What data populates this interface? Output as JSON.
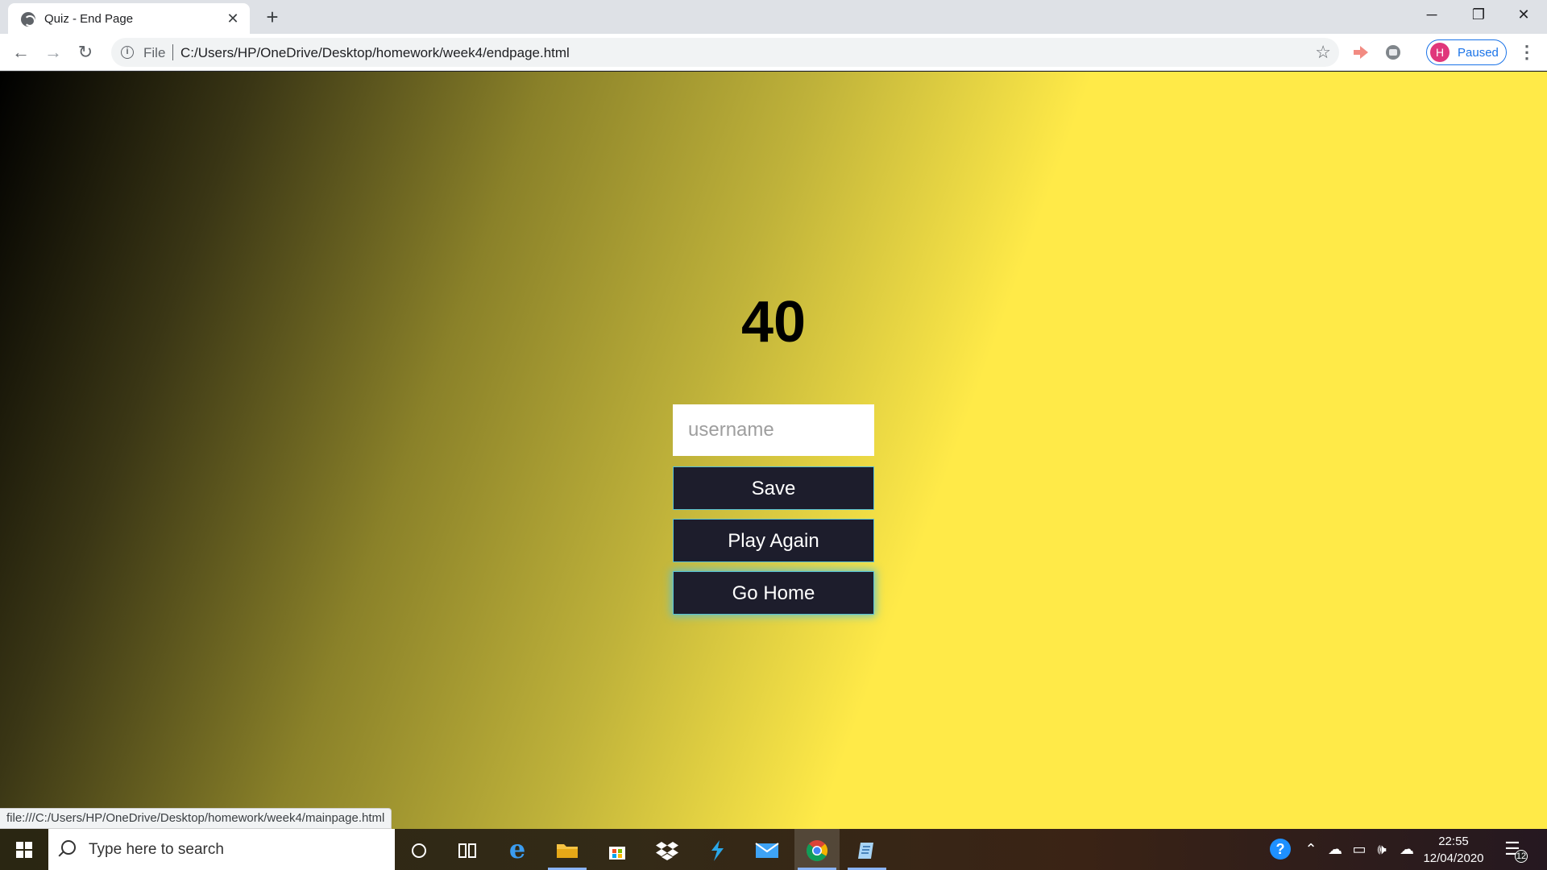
{
  "browser": {
    "tab_title": "Quiz - End Page",
    "tab_close": "✕",
    "new_tab": "+",
    "address_scheme": "File",
    "address_url": "C:/Users/HP/OneDrive/Desktop/homework/week4/endpage.html",
    "profile_initial": "H",
    "profile_status": "Paused",
    "window_controls": {
      "minimize": "─",
      "restore": "❐",
      "close": "✕"
    },
    "nav": {
      "back": "←",
      "forward": "→",
      "reload": "↻"
    }
  },
  "page": {
    "score": "40",
    "username_placeholder": "username",
    "username_value": "",
    "buttons": {
      "save": "Save",
      "play_again": "Play Again",
      "go_home": "Go Home"
    },
    "status_link": "file:///C:/Users/HP/OneDrive/Desktop/homework/week4/mainpage.html"
  },
  "taskbar": {
    "search_placeholder": "Type here to search",
    "time": "22:55",
    "date": "12/04/2020",
    "notification_count": "12",
    "apps": [
      "cortana-icon",
      "task-view-icon",
      "edge-icon",
      "file-explorer-icon",
      "store-icon",
      "dropbox-icon",
      "visual-studio-icon",
      "mail-icon",
      "chrome-icon",
      "notepad-icon"
    ]
  },
  "colors": {
    "button_bg": "#1d1d2c",
    "button_border": "#56c1d6",
    "profile_accent": "#1a73e8",
    "avatar_bg": "#e0377b",
    "gradient_yellow": "#ffea48"
  }
}
